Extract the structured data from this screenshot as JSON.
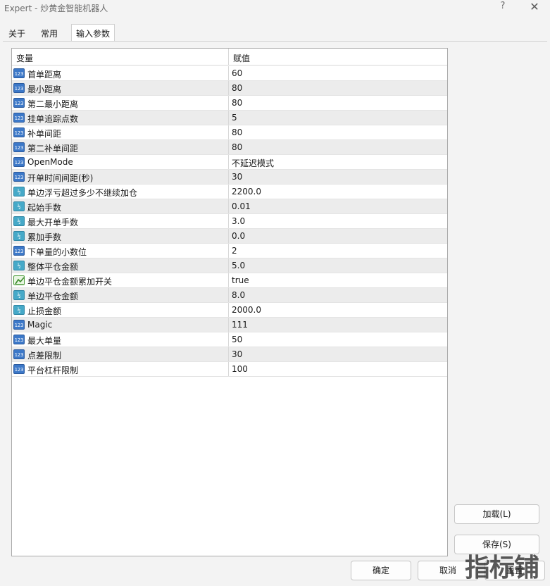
{
  "window": {
    "title": "Expert - 炒黄金智能机器人",
    "help_label": "?",
    "close_label": "✕"
  },
  "tabs": [
    {
      "label": "关于",
      "active": false
    },
    {
      "label": "常用",
      "active": false
    },
    {
      "label": "输入参数",
      "active": true
    }
  ],
  "grid": {
    "headers": {
      "variable": "变量",
      "value": "赋值"
    },
    "rows": [
      {
        "type": "int",
        "name": "首单距离",
        "value": "60"
      },
      {
        "type": "int",
        "name": "最小距离",
        "value": "80"
      },
      {
        "type": "int",
        "name": "第二最小距离",
        "value": "80"
      },
      {
        "type": "int",
        "name": "挂单追踪点数",
        "value": "5"
      },
      {
        "type": "int",
        "name": "补单间距",
        "value": "80"
      },
      {
        "type": "int",
        "name": "第二补单间距",
        "value": "80"
      },
      {
        "type": "int",
        "name": "OpenMode",
        "value": "不延迟模式"
      },
      {
        "type": "int",
        "name": "开单时间间距(秒)",
        "value": "30"
      },
      {
        "type": "double",
        "name": "单边浮亏超过多少不继续加仓",
        "value": "2200.0"
      },
      {
        "type": "double",
        "name": "起始手数",
        "value": "0.01"
      },
      {
        "type": "double",
        "name": "最大开单手数",
        "value": "3.0"
      },
      {
        "type": "double",
        "name": "累加手数",
        "value": "0.0"
      },
      {
        "type": "int",
        "name": "下单量的小数位",
        "value": "2"
      },
      {
        "type": "double",
        "name": "整体平仓金额",
        "value": "5.0"
      },
      {
        "type": "bool",
        "name": "单边平仓金额累加开关",
        "value": "true"
      },
      {
        "type": "double",
        "name": "单边平仓金额",
        "value": "8.0"
      },
      {
        "type": "double",
        "name": "止损金额",
        "value": "2000.0"
      },
      {
        "type": "int",
        "name": "Magic",
        "value": "111"
      },
      {
        "type": "int",
        "name": "最大单量",
        "value": "50"
      },
      {
        "type": "int",
        "name": "点差限制",
        "value": "30"
      },
      {
        "type": "int",
        "name": "平台杠杆限制",
        "value": "100"
      }
    ]
  },
  "icons": {
    "int": {
      "name": "integer-type-icon",
      "glyph": "123",
      "color": "#3c78c8"
    },
    "double": {
      "name": "double-type-icon",
      "glyph": "½",
      "color": "#46a9c8"
    },
    "bool": {
      "name": "bool-type-icon",
      "glyph": "",
      "color": "#4a9a3a"
    }
  },
  "buttons": {
    "load": "加载(L)",
    "save": "保存(S)",
    "ok": "确定",
    "cancel": "取消",
    "reset": "重置"
  },
  "watermark": "指标铺"
}
